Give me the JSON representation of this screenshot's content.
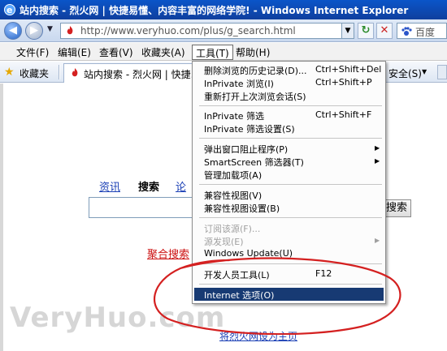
{
  "window": {
    "title": "站内搜索 - 烈火网 | 快捷易懂、内容丰富的网络学院! - Windows Internet Explorer"
  },
  "address_bar": {
    "url": "http://www.veryhuo.com/plus/g_search.html",
    "search_placeholder": "百度"
  },
  "menu_bar": {
    "items": [
      "文件(F)",
      "编辑(E)",
      "查看(V)",
      "收藏夹(A)",
      "工具(T)",
      "帮助(H)"
    ]
  },
  "favorites_bar": {
    "label": "收藏夹",
    "tab_title": "站内搜索 - 烈火网 | 快捷...",
    "safety": "安全(S)"
  },
  "page": {
    "tabs": [
      "资讯",
      "搜索",
      "论"
    ],
    "search_button": "搜索",
    "aggregate_link": "聚合搜索",
    "set_home_link": "将烈火网设为主页",
    "watermark": "VeryHuo.com"
  },
  "tools_menu": {
    "items": [
      {
        "label": "删除浏览的历史记录(D)...",
        "shortcut": "Ctrl+Shift+Del"
      },
      {
        "label": "InPrivate 浏览(I)",
        "shortcut": "Ctrl+Shift+P"
      },
      {
        "label": "重新打开上次浏览会话(S)",
        "shortcut": ""
      },
      {
        "label": "InPrivate 筛选",
        "shortcut": "Ctrl+Shift+F"
      },
      {
        "label": "InPrivate 筛选设置(S)",
        "shortcut": ""
      },
      {
        "label": "弹出窗口阻止程序(P)",
        "shortcut": ""
      },
      {
        "label": "SmartScreen 筛选器(T)",
        "shortcut": ""
      },
      {
        "label": "管理加载项(A)",
        "shortcut": ""
      },
      {
        "label": "兼容性视图(V)",
        "shortcut": ""
      },
      {
        "label": "兼容性视图设置(B)",
        "shortcut": ""
      },
      {
        "label": "订阅该源(F)...",
        "shortcut": ""
      },
      {
        "label": "源发现(E)",
        "shortcut": ""
      },
      {
        "label": "Windows Update(U)",
        "shortcut": ""
      },
      {
        "label": "开发人员工具(L)",
        "shortcut": "F12"
      },
      {
        "label": "Internet 选项(O)",
        "shortcut": ""
      }
    ]
  },
  "colors": {
    "title_bar": "#0f3f9e",
    "menu_highlight": "#173a73",
    "annotation": "#d42020",
    "link": "#1a3fb5"
  }
}
